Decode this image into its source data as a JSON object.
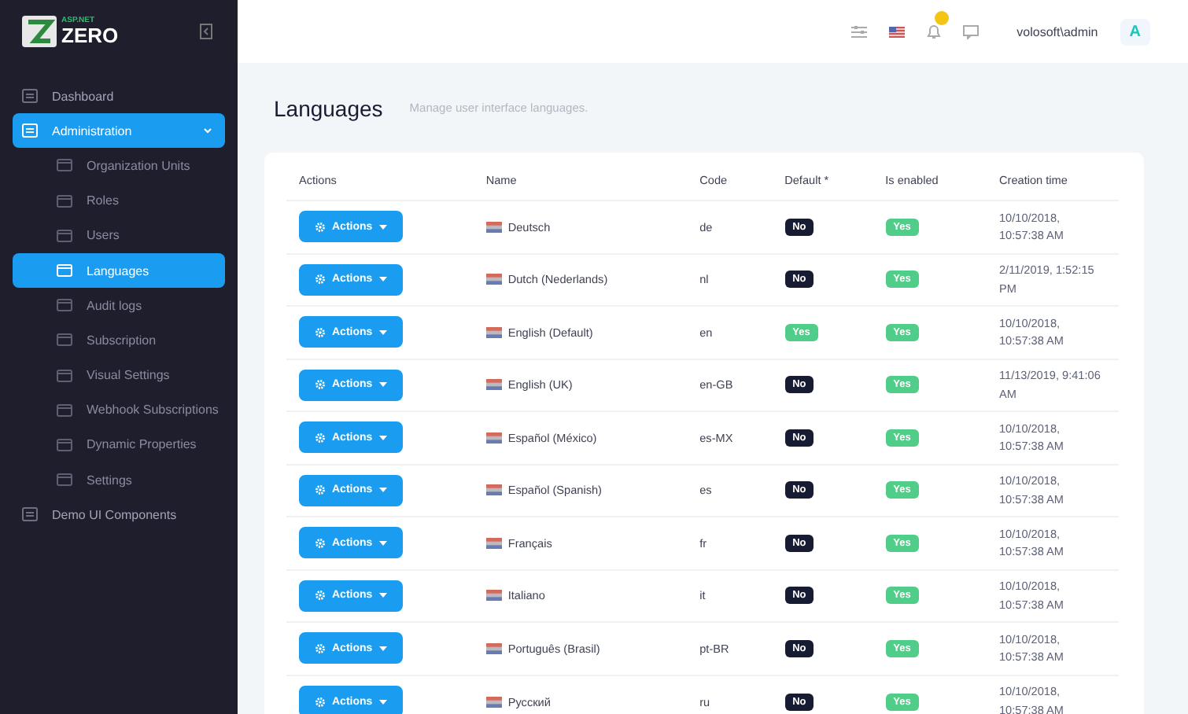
{
  "sidebar": {
    "logo": {
      "small": "ASP.NET",
      "big": "ZERO"
    },
    "items": [
      {
        "label": "Dashboard",
        "selected": false
      },
      {
        "label": "Administration",
        "selected": true,
        "expanded": true,
        "children": [
          {
            "label": "Organization Units",
            "selected": false
          },
          {
            "label": "Roles",
            "selected": false
          },
          {
            "label": "Users",
            "selected": false
          },
          {
            "label": "Languages",
            "selected": true
          },
          {
            "label": "Audit logs",
            "selected": false
          },
          {
            "label": "Subscription",
            "selected": false
          },
          {
            "label": "Visual Settings",
            "selected": false
          },
          {
            "label": "Webhook Subscriptions",
            "selected": false
          },
          {
            "label": "Dynamic Properties",
            "selected": false
          },
          {
            "label": "Settings",
            "selected": false
          }
        ]
      },
      {
        "label": "Demo UI Components",
        "selected": false
      }
    ]
  },
  "header": {
    "user": "volosoft\\admin",
    "avatar": "A"
  },
  "page": {
    "title": "Languages",
    "subtitle": "Manage user interface languages."
  },
  "table": {
    "columns": [
      "Actions",
      "Name",
      "Code",
      "Default *",
      "Is enabled",
      "Creation time"
    ],
    "rows": [
      {
        "action": "Actions",
        "name": "Deutsch",
        "code": "de",
        "default": {
          "label": "No",
          "on": false
        },
        "enabled": {
          "label": "Yes",
          "on": true
        },
        "created": "10/10/2018, 10:57:38 AM"
      },
      {
        "action": "Actions",
        "name": "Dutch (Nederlands)",
        "code": "nl",
        "default": {
          "label": "No",
          "on": false
        },
        "enabled": {
          "label": "Yes",
          "on": true
        },
        "created": "2/11/2019, 1:52:15 PM"
      },
      {
        "action": "Actions",
        "name": "English (Default)",
        "code": "en",
        "default": {
          "label": "Yes",
          "on": true
        },
        "enabled": {
          "label": "Yes",
          "on": true
        },
        "created": "10/10/2018, 10:57:38 AM"
      },
      {
        "action": "Actions",
        "name": "English (UK)",
        "code": "en-GB",
        "default": {
          "label": "No",
          "on": false
        },
        "enabled": {
          "label": "Yes",
          "on": true
        },
        "created": "11/13/2019, 9:41:06 AM"
      },
      {
        "action": "Actions",
        "name": "Español (México)",
        "code": "es-MX",
        "default": {
          "label": "No",
          "on": false
        },
        "enabled": {
          "label": "Yes",
          "on": true
        },
        "created": "10/10/2018, 10:57:38 AM"
      },
      {
        "action": "Actions",
        "name": "Español (Spanish)",
        "code": "es",
        "default": {
          "label": "No",
          "on": false
        },
        "enabled": {
          "label": "Yes",
          "on": true
        },
        "created": "10/10/2018, 10:57:38 AM"
      },
      {
        "action": "Actions",
        "name": "Français",
        "code": "fr",
        "default": {
          "label": "No",
          "on": false
        },
        "enabled": {
          "label": "Yes",
          "on": true
        },
        "created": "10/10/2018, 10:57:38 AM"
      },
      {
        "action": "Actions",
        "name": "Italiano",
        "code": "it",
        "default": {
          "label": "No",
          "on": false
        },
        "enabled": {
          "label": "Yes",
          "on": true
        },
        "created": "10/10/2018, 10:57:38 AM"
      },
      {
        "action": "Actions",
        "name": "Português (Brasil)",
        "code": "pt-BR",
        "default": {
          "label": "No",
          "on": false
        },
        "enabled": {
          "label": "Yes",
          "on": true
        },
        "created": "10/10/2018, 10:57:38 AM"
      },
      {
        "action": "Actions",
        "name": "Русский",
        "code": "ru",
        "default": {
          "label": "No",
          "on": false
        },
        "enabled": {
          "label": "Yes",
          "on": true
        },
        "created": "10/10/2018, 10:57:38 AM"
      }
    ]
  }
}
